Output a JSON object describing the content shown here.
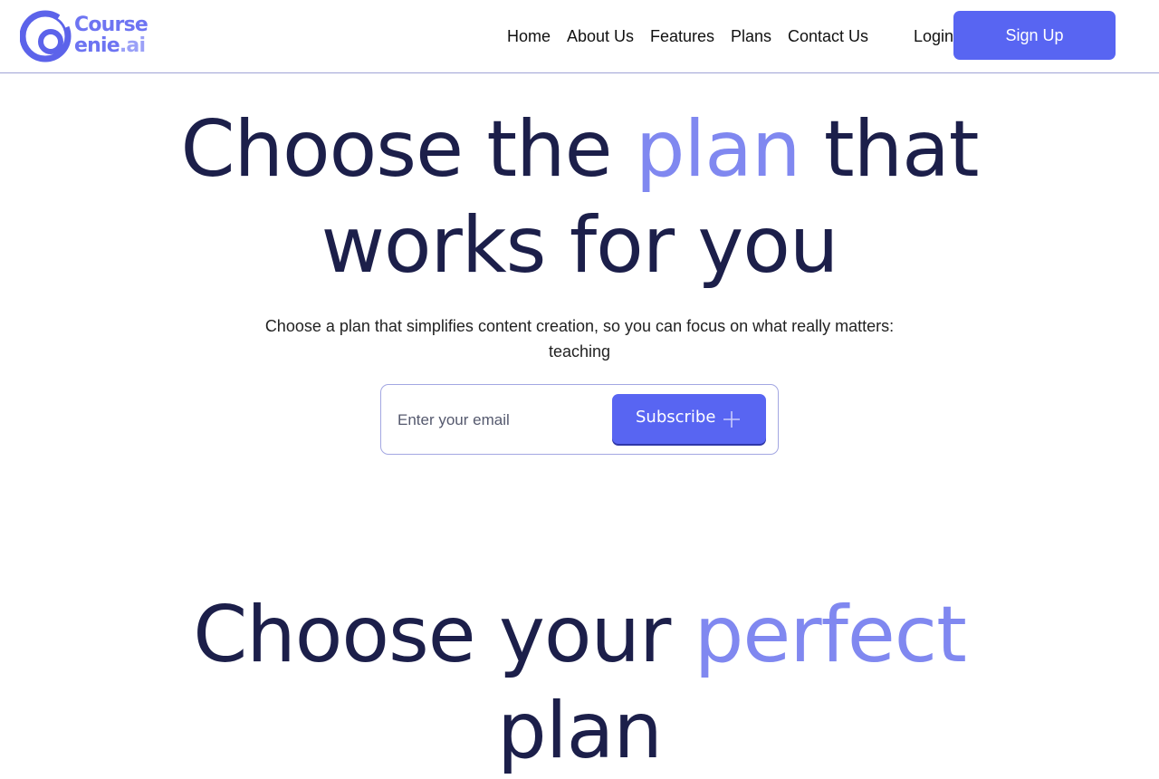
{
  "header": {
    "logo": {
      "word_top": "Course",
      "word_bottom_main": "enie",
      "word_bottom_ai": ".ai"
    },
    "nav": {
      "home": "Home",
      "about": "About Us",
      "features": "Features",
      "plans": "Plans",
      "contact": "Contact Us",
      "login": "Login"
    },
    "signup_label": "Sign Up"
  },
  "hero": {
    "title_part1": "Choose the ",
    "title_accent": "plan",
    "title_part2": " that",
    "title_line2": "works for you",
    "subtitle": "Choose a plan that simplifies content creation, so you can focus on what really matters: teaching"
  },
  "subscribe": {
    "placeholder": "Enter your email",
    "button_label": "Subscribe"
  },
  "plans_section": {
    "title_part1": "Choose your ",
    "title_accent": "perfect",
    "title_line2": "plan"
  },
  "colors": {
    "accent": "#8088f0",
    "primary": "#5865f2",
    "heading": "#1c1f4a"
  }
}
